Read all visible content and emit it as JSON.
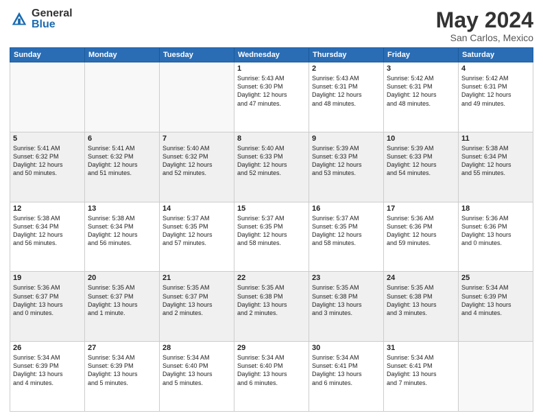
{
  "logo": {
    "general": "General",
    "blue": "Blue"
  },
  "title": "May 2024",
  "location": "San Carlos, Mexico",
  "days_header": [
    "Sunday",
    "Monday",
    "Tuesday",
    "Wednesday",
    "Thursday",
    "Friday",
    "Saturday"
  ],
  "rows": [
    [
      {
        "day": "",
        "text": "",
        "empty": true
      },
      {
        "day": "",
        "text": "",
        "empty": true
      },
      {
        "day": "",
        "text": "",
        "empty": true
      },
      {
        "day": "1",
        "text": "Sunrise: 5:43 AM\nSunset: 6:30 PM\nDaylight: 12 hours\nand 47 minutes."
      },
      {
        "day": "2",
        "text": "Sunrise: 5:43 AM\nSunset: 6:31 PM\nDaylight: 12 hours\nand 48 minutes."
      },
      {
        "day": "3",
        "text": "Sunrise: 5:42 AM\nSunset: 6:31 PM\nDaylight: 12 hours\nand 48 minutes."
      },
      {
        "day": "4",
        "text": "Sunrise: 5:42 AM\nSunset: 6:31 PM\nDaylight: 12 hours\nand 49 minutes."
      }
    ],
    [
      {
        "day": "5",
        "text": "Sunrise: 5:41 AM\nSunset: 6:32 PM\nDaylight: 12 hours\nand 50 minutes."
      },
      {
        "day": "6",
        "text": "Sunrise: 5:41 AM\nSunset: 6:32 PM\nDaylight: 12 hours\nand 51 minutes."
      },
      {
        "day": "7",
        "text": "Sunrise: 5:40 AM\nSunset: 6:32 PM\nDaylight: 12 hours\nand 52 minutes."
      },
      {
        "day": "8",
        "text": "Sunrise: 5:40 AM\nSunset: 6:33 PM\nDaylight: 12 hours\nand 52 minutes."
      },
      {
        "day": "9",
        "text": "Sunrise: 5:39 AM\nSunset: 6:33 PM\nDaylight: 12 hours\nand 53 minutes."
      },
      {
        "day": "10",
        "text": "Sunrise: 5:39 AM\nSunset: 6:33 PM\nDaylight: 12 hours\nand 54 minutes."
      },
      {
        "day": "11",
        "text": "Sunrise: 5:38 AM\nSunset: 6:34 PM\nDaylight: 12 hours\nand 55 minutes."
      }
    ],
    [
      {
        "day": "12",
        "text": "Sunrise: 5:38 AM\nSunset: 6:34 PM\nDaylight: 12 hours\nand 56 minutes."
      },
      {
        "day": "13",
        "text": "Sunrise: 5:38 AM\nSunset: 6:34 PM\nDaylight: 12 hours\nand 56 minutes."
      },
      {
        "day": "14",
        "text": "Sunrise: 5:37 AM\nSunset: 6:35 PM\nDaylight: 12 hours\nand 57 minutes."
      },
      {
        "day": "15",
        "text": "Sunrise: 5:37 AM\nSunset: 6:35 PM\nDaylight: 12 hours\nand 58 minutes."
      },
      {
        "day": "16",
        "text": "Sunrise: 5:37 AM\nSunset: 6:35 PM\nDaylight: 12 hours\nand 58 minutes."
      },
      {
        "day": "17",
        "text": "Sunrise: 5:36 AM\nSunset: 6:36 PM\nDaylight: 12 hours\nand 59 minutes."
      },
      {
        "day": "18",
        "text": "Sunrise: 5:36 AM\nSunset: 6:36 PM\nDaylight: 13 hours\nand 0 minutes."
      }
    ],
    [
      {
        "day": "19",
        "text": "Sunrise: 5:36 AM\nSunset: 6:37 PM\nDaylight: 13 hours\nand 0 minutes."
      },
      {
        "day": "20",
        "text": "Sunrise: 5:35 AM\nSunset: 6:37 PM\nDaylight: 13 hours\nand 1 minute."
      },
      {
        "day": "21",
        "text": "Sunrise: 5:35 AM\nSunset: 6:37 PM\nDaylight: 13 hours\nand 2 minutes."
      },
      {
        "day": "22",
        "text": "Sunrise: 5:35 AM\nSunset: 6:38 PM\nDaylight: 13 hours\nand 2 minutes."
      },
      {
        "day": "23",
        "text": "Sunrise: 5:35 AM\nSunset: 6:38 PM\nDaylight: 13 hours\nand 3 minutes."
      },
      {
        "day": "24",
        "text": "Sunrise: 5:35 AM\nSunset: 6:38 PM\nDaylight: 13 hours\nand 3 minutes."
      },
      {
        "day": "25",
        "text": "Sunrise: 5:34 AM\nSunset: 6:39 PM\nDaylight: 13 hours\nand 4 minutes."
      }
    ],
    [
      {
        "day": "26",
        "text": "Sunrise: 5:34 AM\nSunset: 6:39 PM\nDaylight: 13 hours\nand 4 minutes."
      },
      {
        "day": "27",
        "text": "Sunrise: 5:34 AM\nSunset: 6:39 PM\nDaylight: 13 hours\nand 5 minutes."
      },
      {
        "day": "28",
        "text": "Sunrise: 5:34 AM\nSunset: 6:40 PM\nDaylight: 13 hours\nand 5 minutes."
      },
      {
        "day": "29",
        "text": "Sunrise: 5:34 AM\nSunset: 6:40 PM\nDaylight: 13 hours\nand 6 minutes."
      },
      {
        "day": "30",
        "text": "Sunrise: 5:34 AM\nSunset: 6:41 PM\nDaylight: 13 hours\nand 6 minutes."
      },
      {
        "day": "31",
        "text": "Sunrise: 5:34 AM\nSunset: 6:41 PM\nDaylight: 13 hours\nand 7 minutes."
      },
      {
        "day": "",
        "text": "",
        "empty": true
      }
    ]
  ]
}
